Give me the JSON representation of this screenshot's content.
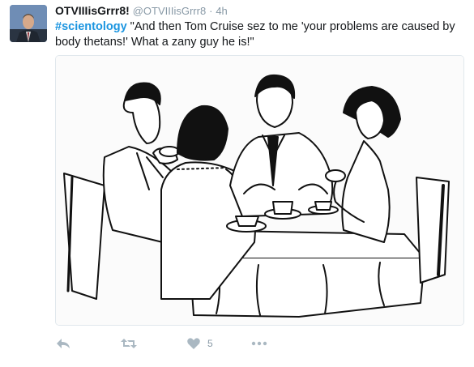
{
  "tweet": {
    "display_name": "OTVIIIisGrrr8!",
    "handle": "@OTVIIIisGrrr8",
    "separator": "·",
    "timestamp": "4h",
    "hashtag": "#scientology",
    "body": " \"And then Tom Cruise sez to me 'your problems are caused by body thetans!' What a zany guy he is!\"",
    "hashtag_color": "#1b95e0"
  },
  "actions": {
    "reply_icon": "reply-icon",
    "retweet_icon": "retweet-icon",
    "like_icon": "heart-icon",
    "like_count": "5",
    "more_icon": "more-icon"
  },
  "colors": {
    "name": "#14171a",
    "muted": "#8899a6",
    "icon": "#aab8c2"
  }
}
